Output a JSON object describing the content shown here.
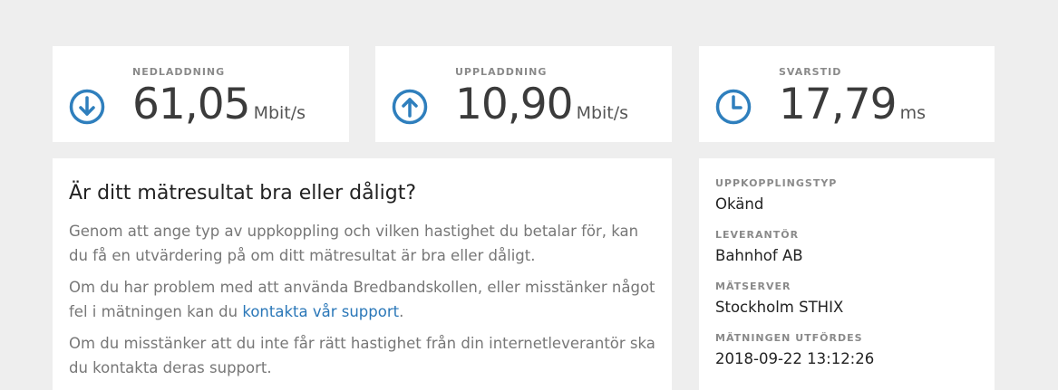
{
  "metrics": {
    "download": {
      "label": "NEDLADDNING",
      "value": "61,05",
      "unit": "Mbit/s",
      "icon": "arrow-down-circle-icon"
    },
    "upload": {
      "label": "UPPLADDNING",
      "value": "10,90",
      "unit": "Mbit/s",
      "icon": "arrow-up-circle-icon"
    },
    "ping": {
      "label": "SVARSTID",
      "value": "17,79",
      "unit": "ms",
      "icon": "clock-icon"
    }
  },
  "info": {
    "heading": "Är ditt mätresultat bra eller dåligt?",
    "paragraph1": "Genom att ange typ av uppkoppling och vilken hastighet du betalar för, kan du få en utvärdering på om ditt mätresultat är bra eller dåligt.",
    "paragraph2_before": "Om du har problem med att använda Bredbandskollen, eller misstänker något fel i mätningen kan du ",
    "paragraph2_link": "kontakta vår support",
    "paragraph2_after": ".",
    "paragraph3": "Om du misstänker att du inte får rätt hastighet från din internetleverantör ska du kontakta deras support."
  },
  "details": [
    {
      "label": "UPPKOPPLINGSTYP",
      "value": "Okänd"
    },
    {
      "label": "LEVERANTÖR",
      "value": "Bahnhof AB"
    },
    {
      "label": "MÄTSERVER",
      "value": "Stockholm STHIX"
    },
    {
      "label": "MÄTNINGEN UTFÖRDES",
      "value": "2018-09-22 13:12:26"
    }
  ],
  "colors": {
    "accent": "#2f7fbd",
    "link": "#2a77b8",
    "background": "#eeeeee"
  }
}
